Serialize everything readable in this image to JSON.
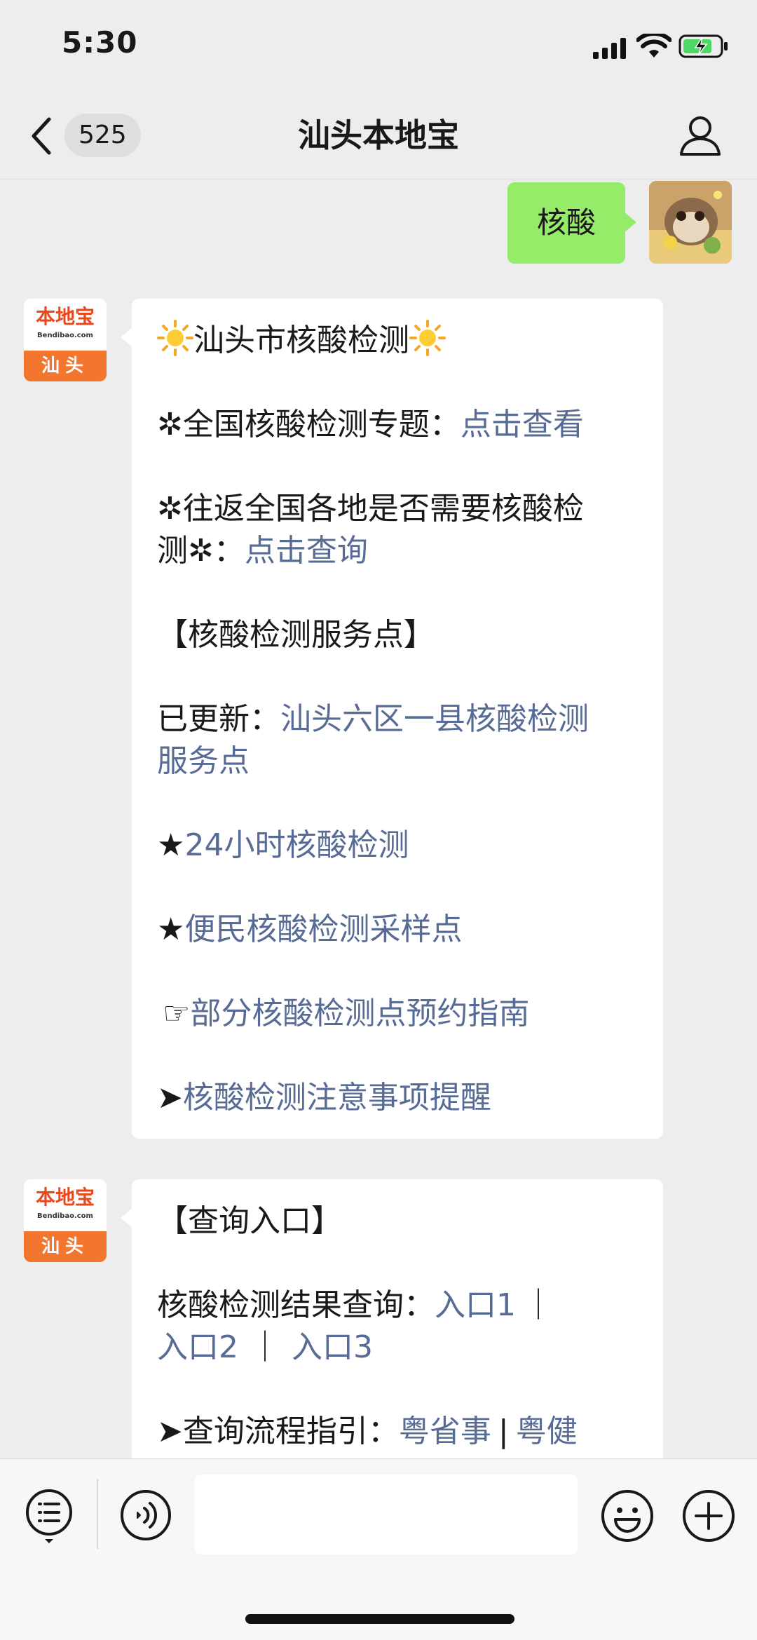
{
  "status_bar": {
    "time": "5:30"
  },
  "nav": {
    "unread_count": "525",
    "title": "汕头本地宝"
  },
  "outgoing_message": {
    "text": "核酸"
  },
  "bot_logo": {
    "name": "本地宝",
    "en": "Bendibao.com",
    "city": "汕头"
  },
  "message1": {
    "title": "汕头市核酸检测",
    "topic_prefix": "✲全国核酸检测专题：",
    "topic_link": "点击查看",
    "travel_line1": "✲往返全国各地是否需要核酸检",
    "travel_line2_prefix": "测✲：",
    "travel_link": "点击查询",
    "section_heading": "【核酸检测服务点】",
    "updated_prefix": "已更新：",
    "updated_link_line1": "汕头六区一县核酸检测",
    "updated_link_line2": "服务点",
    "item_24h_marker": "★",
    "item_24h_link": "24小时核酸检测",
    "item_sampling_marker": "★",
    "item_sampling_link": "便民核酸检测采样点",
    "item_booking_marker": "☞",
    "item_booking_link": "部分核酸检测点预约指南",
    "item_notes_marker": "➤",
    "item_notes_link": "核酸检测注意事项提醒"
  },
  "message2": {
    "heading": "【查询入口】",
    "result_prefix": "核酸检测结果查询：",
    "entry1": "入口1",
    "separator": "｜",
    "entry2": "入口2",
    "entry3": "入口3",
    "guide_prefix": "➤查询流程指引：",
    "guide_link1": "粤省事",
    "guide_separator": "|",
    "guide_link2": "粤健"
  },
  "input_bar": {
    "placeholder": ""
  },
  "colors": {
    "bubble_out": "#95ec69",
    "link": "#576b95",
    "background": "#ededed",
    "logo_orange": "#f2762e"
  }
}
